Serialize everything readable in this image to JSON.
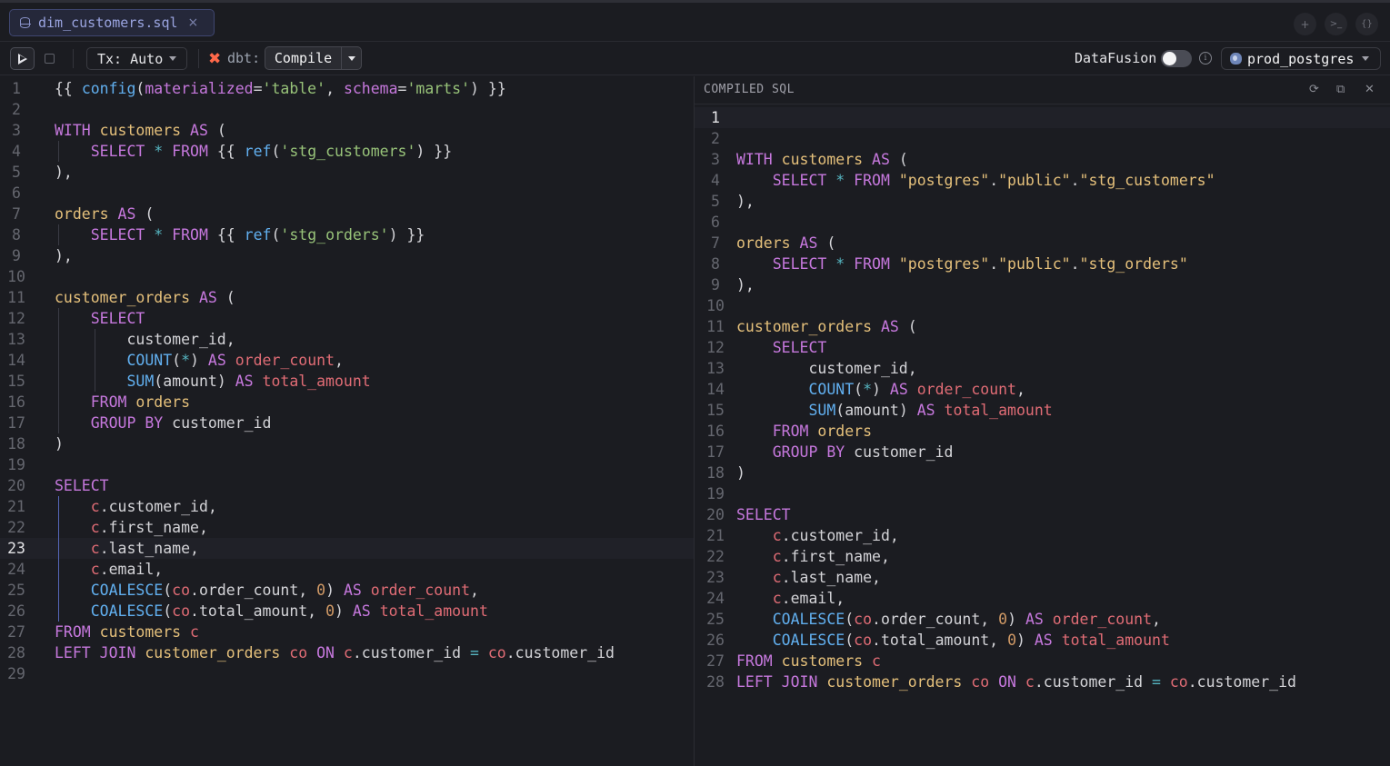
{
  "tab": {
    "title": "dim_customers.sql",
    "close": "×"
  },
  "tab_actions": {
    "add": "+",
    "terminal": ">_",
    "format": "{}"
  },
  "toolbar": {
    "tx_label": "Tx: Auto",
    "dbt_label": "dbt:",
    "compile_label": "Compile",
    "datafusion_label": "DataFusion",
    "datafusion_enabled": false,
    "info": "i",
    "connection": "prod_postgres"
  },
  "compiled_panel": {
    "title": "COMPILED SQL"
  },
  "colors": {
    "keyword": "#c678dd",
    "function": "#61afef",
    "string": "#98c379",
    "identifier": "#e5c07b",
    "alias": "#e06c75",
    "operator": "#56b6c2",
    "number": "#d19a66"
  },
  "editor": {
    "current_line": 23,
    "lines": [
      [
        [
          "p",
          "{{ "
        ],
        [
          "f",
          "config"
        ],
        [
          "p",
          "("
        ],
        [
          "k",
          "materialized"
        ],
        [
          "p",
          "="
        ],
        [
          "s",
          "'table'"
        ],
        [
          "p",
          ", "
        ],
        [
          "k",
          "schema"
        ],
        [
          "p",
          "="
        ],
        [
          "s",
          "'marts'"
        ],
        [
          "p",
          ") }}"
        ]
      ],
      [],
      [
        [
          "k",
          "WITH "
        ],
        [
          "i",
          "customers "
        ],
        [
          "k",
          "AS "
        ],
        [
          "p",
          "("
        ]
      ],
      [
        [
          "p",
          "    "
        ],
        [
          "k",
          "SELECT "
        ],
        [
          "o",
          "* "
        ],
        [
          "k",
          "FROM "
        ],
        [
          "p",
          "{{ "
        ],
        [
          "f",
          "ref"
        ],
        [
          "p",
          "("
        ],
        [
          "s",
          "'stg_customers'"
        ],
        [
          "p",
          ") }}"
        ]
      ],
      [
        [
          "p",
          "),"
        ]
      ],
      [],
      [
        [
          "i",
          "orders "
        ],
        [
          "k",
          "AS "
        ],
        [
          "p",
          "("
        ]
      ],
      [
        [
          "p",
          "    "
        ],
        [
          "k",
          "SELECT "
        ],
        [
          "o",
          "* "
        ],
        [
          "k",
          "FROM "
        ],
        [
          "p",
          "{{ "
        ],
        [
          "f",
          "ref"
        ],
        [
          "p",
          "("
        ],
        [
          "s",
          "'stg_orders'"
        ],
        [
          "p",
          ") }}"
        ]
      ],
      [
        [
          "p",
          "),"
        ]
      ],
      [],
      [
        [
          "i",
          "customer_orders "
        ],
        [
          "k",
          "AS "
        ],
        [
          "p",
          "("
        ]
      ],
      [
        [
          "p",
          "    "
        ],
        [
          "k",
          "SELECT"
        ]
      ],
      [
        [
          "p",
          "        customer_id,"
        ]
      ],
      [
        [
          "p",
          "        "
        ],
        [
          "f",
          "COUNT"
        ],
        [
          "p",
          "("
        ],
        [
          "o",
          "*"
        ],
        [
          "p",
          ") "
        ],
        [
          "k",
          "AS "
        ],
        [
          "a",
          "order_count"
        ],
        [
          "p",
          ","
        ]
      ],
      [
        [
          "p",
          "        "
        ],
        [
          "f",
          "SUM"
        ],
        [
          "p",
          "(amount) "
        ],
        [
          "k",
          "AS "
        ],
        [
          "a",
          "total_amount"
        ]
      ],
      [
        [
          "p",
          "    "
        ],
        [
          "k",
          "FROM "
        ],
        [
          "i",
          "orders"
        ]
      ],
      [
        [
          "p",
          "    "
        ],
        [
          "k",
          "GROUP BY "
        ],
        [
          "p",
          "customer_id"
        ]
      ],
      [
        [
          "p",
          ")"
        ]
      ],
      [],
      [
        [
          "k",
          "SELECT"
        ]
      ],
      [
        [
          "p",
          "    "
        ],
        [
          "a",
          "c"
        ],
        [
          "p",
          ".customer_id,"
        ]
      ],
      [
        [
          "p",
          "    "
        ],
        [
          "a",
          "c"
        ],
        [
          "p",
          ".first_name,"
        ]
      ],
      [
        [
          "p",
          "    "
        ],
        [
          "a",
          "c"
        ],
        [
          "p",
          ".last_name,"
        ]
      ],
      [
        [
          "p",
          "    "
        ],
        [
          "a",
          "c"
        ],
        [
          "p",
          ".email,"
        ]
      ],
      [
        [
          "p",
          "    "
        ],
        [
          "f",
          "COALESCE"
        ],
        [
          "p",
          "("
        ],
        [
          "a",
          "co"
        ],
        [
          "p",
          ".order_count, "
        ],
        [
          "n",
          "0"
        ],
        [
          "p",
          ") "
        ],
        [
          "k",
          "AS "
        ],
        [
          "a",
          "order_count"
        ],
        [
          "p",
          ","
        ]
      ],
      [
        [
          "p",
          "    "
        ],
        [
          "f",
          "COALESCE"
        ],
        [
          "p",
          "("
        ],
        [
          "a",
          "co"
        ],
        [
          "p",
          ".total_amount, "
        ],
        [
          "n",
          "0"
        ],
        [
          "p",
          ") "
        ],
        [
          "k",
          "AS "
        ],
        [
          "a",
          "total_amount"
        ]
      ],
      [
        [
          "k",
          "FROM "
        ],
        [
          "i",
          "customers "
        ],
        [
          "a",
          "c"
        ]
      ],
      [
        [
          "k",
          "LEFT JOIN "
        ],
        [
          "i",
          "customer_orders "
        ],
        [
          "a",
          "co "
        ],
        [
          "k",
          "ON "
        ],
        [
          "a",
          "c"
        ],
        [
          "p",
          ".customer_id "
        ],
        [
          "o",
          "= "
        ],
        [
          "a",
          "co"
        ],
        [
          "p",
          ".customer_id"
        ]
      ],
      []
    ]
  },
  "compiled": {
    "lines": [
      [],
      [],
      [
        [
          "k",
          "WITH "
        ],
        [
          "i",
          "customers "
        ],
        [
          "k",
          "AS "
        ],
        [
          "p",
          "("
        ]
      ],
      [
        [
          "p",
          "    "
        ],
        [
          "k",
          "SELECT "
        ],
        [
          "o",
          "* "
        ],
        [
          "k",
          "FROM "
        ],
        [
          "i",
          "\"postgres\""
        ],
        [
          "p",
          "."
        ],
        [
          "i",
          "\"public\""
        ],
        [
          "p",
          "."
        ],
        [
          "i",
          "\"stg_customers\""
        ]
      ],
      [
        [
          "p",
          "),"
        ]
      ],
      [],
      [
        [
          "i",
          "orders "
        ],
        [
          "k",
          "AS "
        ],
        [
          "p",
          "("
        ]
      ],
      [
        [
          "p",
          "    "
        ],
        [
          "k",
          "SELECT "
        ],
        [
          "o",
          "* "
        ],
        [
          "k",
          "FROM "
        ],
        [
          "i",
          "\"postgres\""
        ],
        [
          "p",
          "."
        ],
        [
          "i",
          "\"public\""
        ],
        [
          "p",
          "."
        ],
        [
          "i",
          "\"stg_orders\""
        ]
      ],
      [
        [
          "p",
          "),"
        ]
      ],
      [],
      [
        [
          "i",
          "customer_orders "
        ],
        [
          "k",
          "AS "
        ],
        [
          "p",
          "("
        ]
      ],
      [
        [
          "p",
          "    "
        ],
        [
          "k",
          "SELECT"
        ]
      ],
      [
        [
          "p",
          "        customer_id,"
        ]
      ],
      [
        [
          "p",
          "        "
        ],
        [
          "f",
          "COUNT"
        ],
        [
          "p",
          "("
        ],
        [
          "o",
          "*"
        ],
        [
          "p",
          ") "
        ],
        [
          "k",
          "AS "
        ],
        [
          "a",
          "order_count"
        ],
        [
          "p",
          ","
        ]
      ],
      [
        [
          "p",
          "        "
        ],
        [
          "f",
          "SUM"
        ],
        [
          "p",
          "(amount) "
        ],
        [
          "k",
          "AS "
        ],
        [
          "a",
          "total_amount"
        ]
      ],
      [
        [
          "p",
          "    "
        ],
        [
          "k",
          "FROM "
        ],
        [
          "i",
          "orders"
        ]
      ],
      [
        [
          "p",
          "    "
        ],
        [
          "k",
          "GROUP BY "
        ],
        [
          "p",
          "customer_id"
        ]
      ],
      [
        [
          "p",
          ")"
        ]
      ],
      [],
      [
        [
          "k",
          "SELECT"
        ]
      ],
      [
        [
          "p",
          "    "
        ],
        [
          "a",
          "c"
        ],
        [
          "p",
          ".customer_id,"
        ]
      ],
      [
        [
          "p",
          "    "
        ],
        [
          "a",
          "c"
        ],
        [
          "p",
          ".first_name,"
        ]
      ],
      [
        [
          "p",
          "    "
        ],
        [
          "a",
          "c"
        ],
        [
          "p",
          ".last_name,"
        ]
      ],
      [
        [
          "p",
          "    "
        ],
        [
          "a",
          "c"
        ],
        [
          "p",
          ".email,"
        ]
      ],
      [
        [
          "p",
          "    "
        ],
        [
          "f",
          "COALESCE"
        ],
        [
          "p",
          "("
        ],
        [
          "a",
          "co"
        ],
        [
          "p",
          ".order_count, "
        ],
        [
          "n",
          "0"
        ],
        [
          "p",
          ") "
        ],
        [
          "k",
          "AS "
        ],
        [
          "a",
          "order_count"
        ],
        [
          "p",
          ","
        ]
      ],
      [
        [
          "p",
          "    "
        ],
        [
          "f",
          "COALESCE"
        ],
        [
          "p",
          "("
        ],
        [
          "a",
          "co"
        ],
        [
          "p",
          ".total_amount, "
        ],
        [
          "n",
          "0"
        ],
        [
          "p",
          ") "
        ],
        [
          "k",
          "AS "
        ],
        [
          "a",
          "total_amount"
        ]
      ],
      [
        [
          "k",
          "FROM "
        ],
        [
          "i",
          "customers "
        ],
        [
          "a",
          "c"
        ]
      ],
      [
        [
          "k",
          "LEFT JOIN "
        ],
        [
          "i",
          "customer_orders "
        ],
        [
          "a",
          "co "
        ],
        [
          "k",
          "ON "
        ],
        [
          "a",
          "c"
        ],
        [
          "p",
          ".customer_id "
        ],
        [
          "o",
          "= "
        ],
        [
          "a",
          "co"
        ],
        [
          "p",
          ".customer_id"
        ]
      ]
    ]
  }
}
